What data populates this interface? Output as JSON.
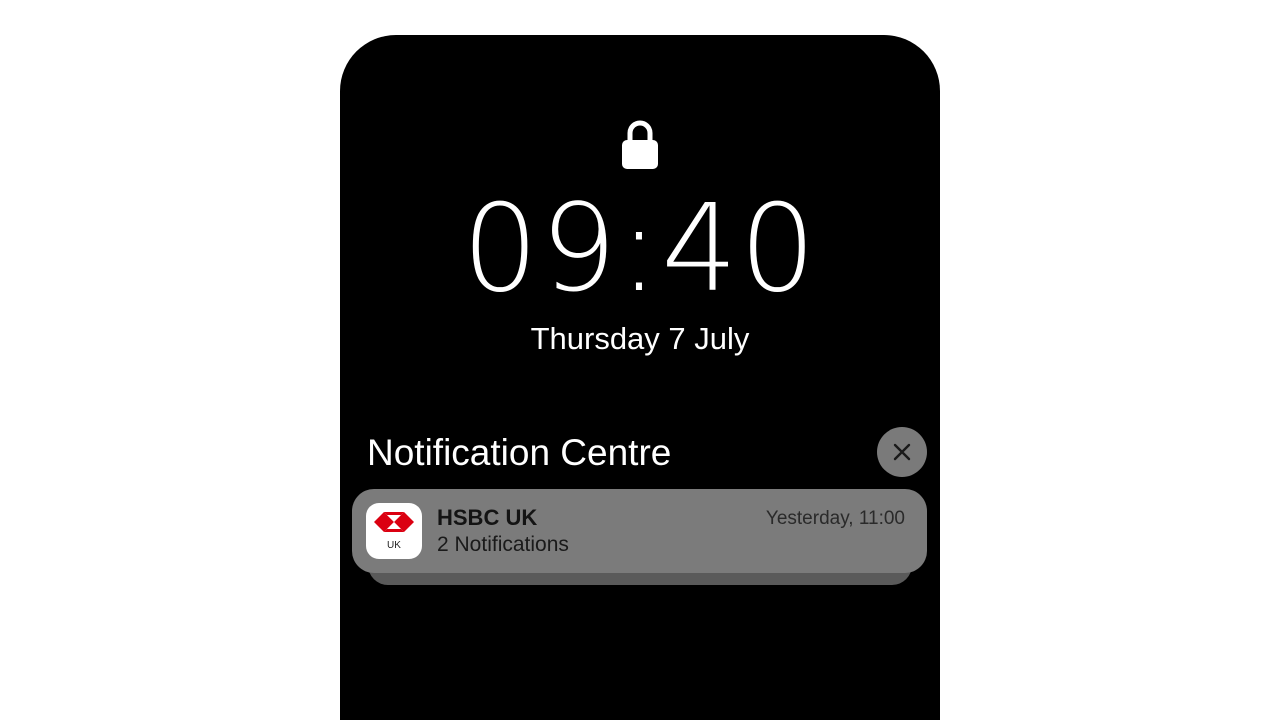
{
  "lock_screen": {
    "lock_icon": "lock-icon",
    "time": "09:40",
    "date": "Thursday 7 July"
  },
  "notification_centre": {
    "title": "Notification Centre",
    "close_icon": "close-icon",
    "notification": {
      "app_name": "HSBC UK",
      "app_icon": "hsbc-uk-app-icon",
      "app_icon_label": "UK",
      "summary": "2 Notifications",
      "timestamp": "Yesterday, 11:00"
    }
  },
  "colors": {
    "screen_background": "#000000",
    "notification_background": "#7b7b7b",
    "close_button_background": "#7a7a7a",
    "hsbc_red": "#db0011"
  }
}
